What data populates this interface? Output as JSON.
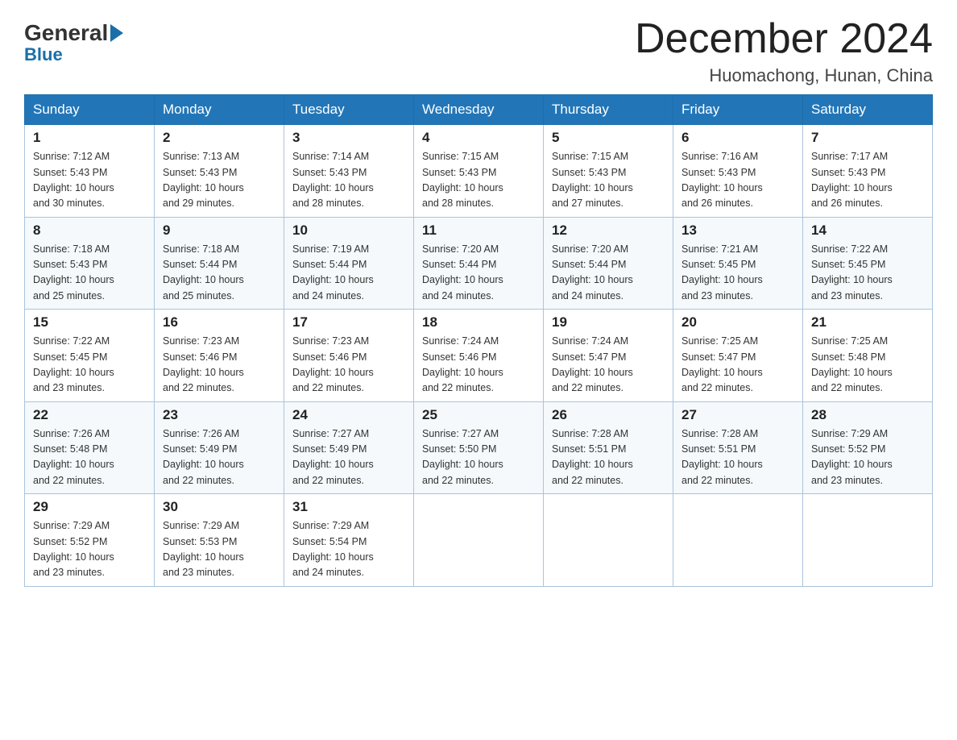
{
  "logo": {
    "general": "General",
    "blue": "Blue"
  },
  "header": {
    "month": "December 2024",
    "location": "Huomachong, Hunan, China"
  },
  "weekdays": [
    "Sunday",
    "Monday",
    "Tuesday",
    "Wednesday",
    "Thursday",
    "Friday",
    "Saturday"
  ],
  "weeks": [
    [
      {
        "day": "1",
        "sunrise": "7:12 AM",
        "sunset": "5:43 PM",
        "daylight": "10 hours and 30 minutes."
      },
      {
        "day": "2",
        "sunrise": "7:13 AM",
        "sunset": "5:43 PM",
        "daylight": "10 hours and 29 minutes."
      },
      {
        "day": "3",
        "sunrise": "7:14 AM",
        "sunset": "5:43 PM",
        "daylight": "10 hours and 28 minutes."
      },
      {
        "day": "4",
        "sunrise": "7:15 AM",
        "sunset": "5:43 PM",
        "daylight": "10 hours and 28 minutes."
      },
      {
        "day": "5",
        "sunrise": "7:15 AM",
        "sunset": "5:43 PM",
        "daylight": "10 hours and 27 minutes."
      },
      {
        "day": "6",
        "sunrise": "7:16 AM",
        "sunset": "5:43 PM",
        "daylight": "10 hours and 26 minutes."
      },
      {
        "day": "7",
        "sunrise": "7:17 AM",
        "sunset": "5:43 PM",
        "daylight": "10 hours and 26 minutes."
      }
    ],
    [
      {
        "day": "8",
        "sunrise": "7:18 AM",
        "sunset": "5:43 PM",
        "daylight": "10 hours and 25 minutes."
      },
      {
        "day": "9",
        "sunrise": "7:18 AM",
        "sunset": "5:44 PM",
        "daylight": "10 hours and 25 minutes."
      },
      {
        "day": "10",
        "sunrise": "7:19 AM",
        "sunset": "5:44 PM",
        "daylight": "10 hours and 24 minutes."
      },
      {
        "day": "11",
        "sunrise": "7:20 AM",
        "sunset": "5:44 PM",
        "daylight": "10 hours and 24 minutes."
      },
      {
        "day": "12",
        "sunrise": "7:20 AM",
        "sunset": "5:44 PM",
        "daylight": "10 hours and 24 minutes."
      },
      {
        "day": "13",
        "sunrise": "7:21 AM",
        "sunset": "5:45 PM",
        "daylight": "10 hours and 23 minutes."
      },
      {
        "day": "14",
        "sunrise": "7:22 AM",
        "sunset": "5:45 PM",
        "daylight": "10 hours and 23 minutes."
      }
    ],
    [
      {
        "day": "15",
        "sunrise": "7:22 AM",
        "sunset": "5:45 PM",
        "daylight": "10 hours and 23 minutes."
      },
      {
        "day": "16",
        "sunrise": "7:23 AM",
        "sunset": "5:46 PM",
        "daylight": "10 hours and 22 minutes."
      },
      {
        "day": "17",
        "sunrise": "7:23 AM",
        "sunset": "5:46 PM",
        "daylight": "10 hours and 22 minutes."
      },
      {
        "day": "18",
        "sunrise": "7:24 AM",
        "sunset": "5:46 PM",
        "daylight": "10 hours and 22 minutes."
      },
      {
        "day": "19",
        "sunrise": "7:24 AM",
        "sunset": "5:47 PM",
        "daylight": "10 hours and 22 minutes."
      },
      {
        "day": "20",
        "sunrise": "7:25 AM",
        "sunset": "5:47 PM",
        "daylight": "10 hours and 22 minutes."
      },
      {
        "day": "21",
        "sunrise": "7:25 AM",
        "sunset": "5:48 PM",
        "daylight": "10 hours and 22 minutes."
      }
    ],
    [
      {
        "day": "22",
        "sunrise": "7:26 AM",
        "sunset": "5:48 PM",
        "daylight": "10 hours and 22 minutes."
      },
      {
        "day": "23",
        "sunrise": "7:26 AM",
        "sunset": "5:49 PM",
        "daylight": "10 hours and 22 minutes."
      },
      {
        "day": "24",
        "sunrise": "7:27 AM",
        "sunset": "5:49 PM",
        "daylight": "10 hours and 22 minutes."
      },
      {
        "day": "25",
        "sunrise": "7:27 AM",
        "sunset": "5:50 PM",
        "daylight": "10 hours and 22 minutes."
      },
      {
        "day": "26",
        "sunrise": "7:28 AM",
        "sunset": "5:51 PM",
        "daylight": "10 hours and 22 minutes."
      },
      {
        "day": "27",
        "sunrise": "7:28 AM",
        "sunset": "5:51 PM",
        "daylight": "10 hours and 22 minutes."
      },
      {
        "day": "28",
        "sunrise": "7:29 AM",
        "sunset": "5:52 PM",
        "daylight": "10 hours and 23 minutes."
      }
    ],
    [
      {
        "day": "29",
        "sunrise": "7:29 AM",
        "sunset": "5:52 PM",
        "daylight": "10 hours and 23 minutes."
      },
      {
        "day": "30",
        "sunrise": "7:29 AM",
        "sunset": "5:53 PM",
        "daylight": "10 hours and 23 minutes."
      },
      {
        "day": "31",
        "sunrise": "7:29 AM",
        "sunset": "5:54 PM",
        "daylight": "10 hours and 24 minutes."
      },
      null,
      null,
      null,
      null
    ]
  ],
  "labels": {
    "sunrise": "Sunrise:",
    "sunset": "Sunset:",
    "daylight": "Daylight:"
  }
}
